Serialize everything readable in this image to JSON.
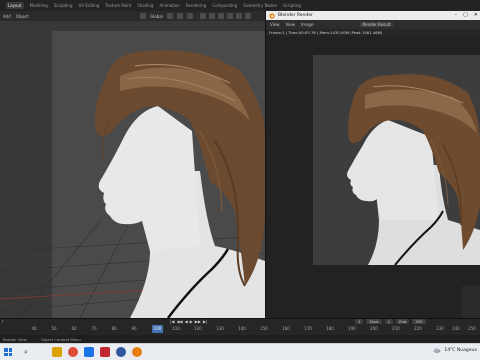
{
  "top_tabs": [
    "Layout",
    "Modeling",
    "Sculpting",
    "UV Editing",
    "Texture Paint",
    "Shading",
    "Animation",
    "Rendering",
    "Compositing",
    "Geometry Nodes",
    "Scripting"
  ],
  "viewport": {
    "menus": [
      "Add",
      "Object"
    ],
    "transform_orientation": "Global"
  },
  "render_window": {
    "title": "Blender Render",
    "menus": [
      "View",
      "View",
      "Image"
    ],
    "slot": "Render Result",
    "stats": "Frame:1 | Time:00:05.76 | Mem:1430.00M (Peak 1561.46M)",
    "controls": [
      "–",
      "▢",
      "✕"
    ]
  },
  "timeline": {
    "left_label": "r",
    "ticks": [
      "40",
      "50",
      "60",
      "70",
      "80",
      "90",
      "100",
      "110",
      "120",
      "130",
      "140",
      "150",
      "160",
      "170",
      "180",
      "190",
      "200",
      "210",
      "220",
      "230",
      "240",
      "250"
    ],
    "current_frame": "1",
    "start_label": "Start",
    "start_value": "1",
    "end_label": "End",
    "end_value": "250",
    "transport": [
      "|◀",
      "◀◀",
      "◀",
      "▶",
      "▶▶",
      "▶|"
    ]
  },
  "statusbar": {
    "items": [
      "Render View",
      "Object Context Menu"
    ]
  },
  "taskbar": {
    "weather": "14°C  Nuageux"
  },
  "colors": {
    "accent": "#4772b3",
    "hair": "#6b4a30",
    "skin": "#e6e6e6"
  }
}
